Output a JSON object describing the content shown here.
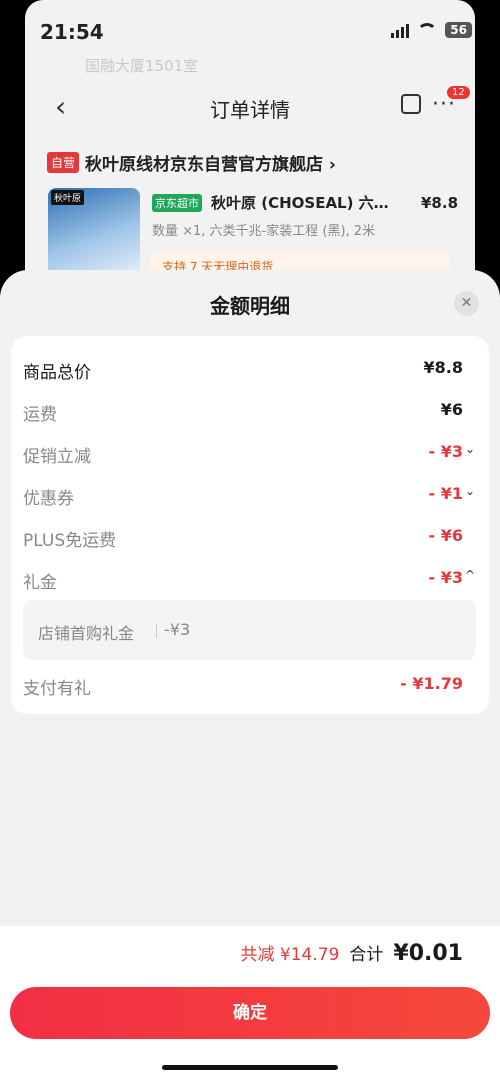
{
  "status_bar": {
    "time": "21:54",
    "battery": "56"
  },
  "background_page": {
    "address": "国融大厦1501室",
    "nav_title": "订单详情",
    "badge_count": "12",
    "store": {
      "self_tag": "自营",
      "name": "秋叶原线材京东自营官方旗舰店 ›"
    },
    "product": {
      "image_label": "秋叶原",
      "mart_tag": "京东超市",
      "name": "秋叶原 (CHOSEAL) 六…",
      "price": "¥8.8",
      "spec": "数量 ×1, 六类千兆-家装工程 (黑), 2米",
      "return_policy": "支持 7 天无理由退货"
    }
  },
  "sheet": {
    "title": "金额明细",
    "rows": [
      {
        "label": "商品总价",
        "value": "¥8.8",
        "chevron": ""
      },
      {
        "label": "运费",
        "value": "¥6",
        "chevron": ""
      },
      {
        "label": "促销立减",
        "value": "- ¥3",
        "chevron": "⌄"
      },
      {
        "label": "优惠券",
        "value": "- ¥1",
        "chevron": "⌄"
      },
      {
        "label": "PLUS免运费",
        "value": "- ¥6",
        "chevron": ""
      },
      {
        "label": "礼金",
        "value": "- ¥3",
        "chevron": "^"
      },
      {
        "label": "支付有礼",
        "value": "- ¥1.79",
        "chevron": ""
      }
    ],
    "gift_detail": {
      "label": "店铺首购礼金",
      "value": "-¥3"
    },
    "footer": {
      "reduce_label": "共减 ¥14.79",
      "total_label": "合计",
      "total_value": "¥0.01",
      "confirm": "确定"
    }
  },
  "colors": {
    "accent_red": "#e4393c",
    "jd_green": "#1fa85a"
  }
}
